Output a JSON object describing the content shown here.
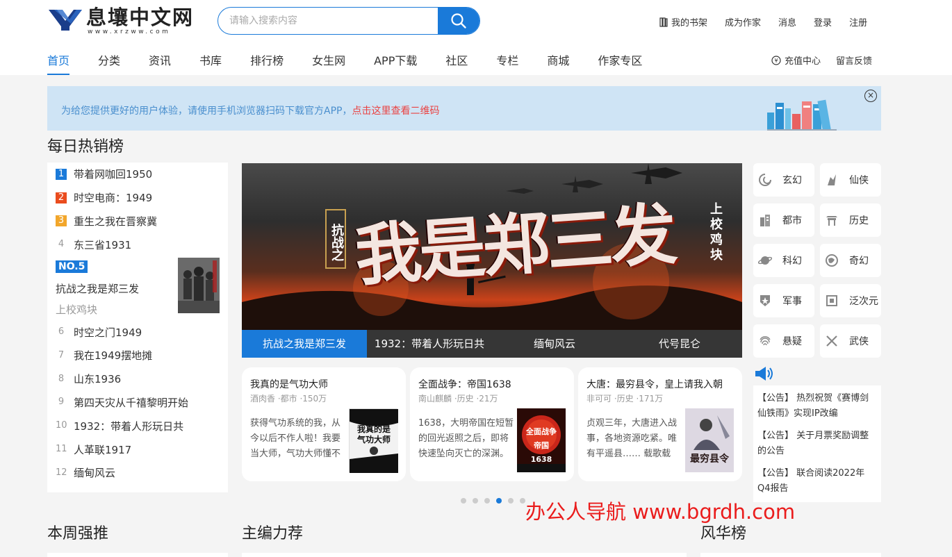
{
  "logo": {
    "name": "息壤中文网",
    "url_text": "www.xrzww.com"
  },
  "search": {
    "placeholder": "请输入搜索内容"
  },
  "toplinks": [
    "我的书架",
    "成为作家",
    "消息",
    "登录",
    "注册"
  ],
  "nav": {
    "items": [
      "首页",
      "分类",
      "资讯",
      "书库",
      "排行榜",
      "女生网",
      "APP下载",
      "社区",
      "专栏",
      "商城",
      "作家专区"
    ],
    "active": 0
  },
  "navright": [
    "充值中心",
    "留言反馈"
  ],
  "banner": {
    "text": "为给您提供更好的用户体验，请使用手机浏览器扫码下载官方APP，",
    "link": "点击这里查看二维码",
    "close": "×"
  },
  "daily": {
    "title": "每日热销榜",
    "items": [
      {
        "rank": "1",
        "title": "带着网咖回1950"
      },
      {
        "rank": "2",
        "title": "时空电商：1949"
      },
      {
        "rank": "3",
        "title": "重生之我在晋察冀"
      },
      {
        "rank": "4",
        "title": "东三省1931"
      },
      {
        "rank": "6",
        "title": "时空之门1949"
      },
      {
        "rank": "7",
        "title": "我在1949摆地摊"
      },
      {
        "rank": "8",
        "title": "山东1936"
      },
      {
        "rank": "9",
        "title": "第四天灾从千禧黎明开始"
      },
      {
        "rank": "10",
        "title": "1932：带着人形玩日共"
      },
      {
        "rank": "11",
        "title": "人革联1917"
      },
      {
        "rank": "12",
        "title": "缅甸风云"
      }
    ],
    "featured": {
      "badge": "NO.5",
      "title": "抗战之我是郑三发",
      "author": "上校鸡块"
    }
  },
  "slider": {
    "cover_title": "我是郑三发",
    "cover_left": "抗战之",
    "cover_right": "上校鸡块",
    "tabs": [
      "抗战之我是郑三发",
      "1932：带着人形玩日共",
      "缅甸风云",
      "代号昆仑"
    ],
    "active_tab": 0,
    "dots_total": 6,
    "active_dot": 3
  },
  "cards": [
    {
      "title": "我真的是气功大师",
      "meta": "酒肉香 ·都市 ·150万",
      "desc": "获得气功系统的我，从今以后不作人啦！我要当大师，气功大师懂不",
      "cover_text": "我真的是气功大师"
    },
    {
      "title": "全面战争：帝国1638",
      "meta": "南山麒麟 ·历史 ·21万",
      "desc": "1638，大明帝国在短暂的回光返照之后，即将快速坠向灭亡的深渊。",
      "cover_text": "全面战争帝国1638"
    },
    {
      "title": "大唐：最穷县令，皇上请我入朝",
      "meta": "非可可 ·历史 ·171万",
      "desc": "贞观三年，大唐进入战事，各地资源吃紧。唯有平遥县…… 载歌载",
      "cover_text": "最穷县令"
    }
  ],
  "genres": [
    {
      "label": "玄幻",
      "icon": "swirl-icon"
    },
    {
      "label": "仙侠",
      "icon": "immortal-icon"
    },
    {
      "label": "都市",
      "icon": "building-icon"
    },
    {
      "label": "历史",
      "icon": "temple-icon"
    },
    {
      "label": "科幻",
      "icon": "planet-icon"
    },
    {
      "label": "奇幻",
      "icon": "globe-icon"
    },
    {
      "label": "军事",
      "icon": "badge-icon"
    },
    {
      "label": "泛次元",
      "icon": "frame-icon"
    },
    {
      "label": "悬疑",
      "icon": "fingerprint-icon"
    },
    {
      "label": "武侠",
      "icon": "swords-icon"
    }
  ],
  "notices": [
    "【公告】 热烈祝贺《赛博剑仙铁雨》实现IP改编",
    "【公告】 关于月票奖励调整的公告",
    "【公告】 联合阅读2022年Q4报告"
  ],
  "sections": {
    "weekly": "本周强推",
    "editor": "主编力荐",
    "fenghua": "风华榜"
  },
  "watermark": "办公人导航 www.bgrdh.com",
  "colors": {
    "accent": "#1a7ad9",
    "red": "#ea4343",
    "banner_bg": "#cfe4f5"
  }
}
